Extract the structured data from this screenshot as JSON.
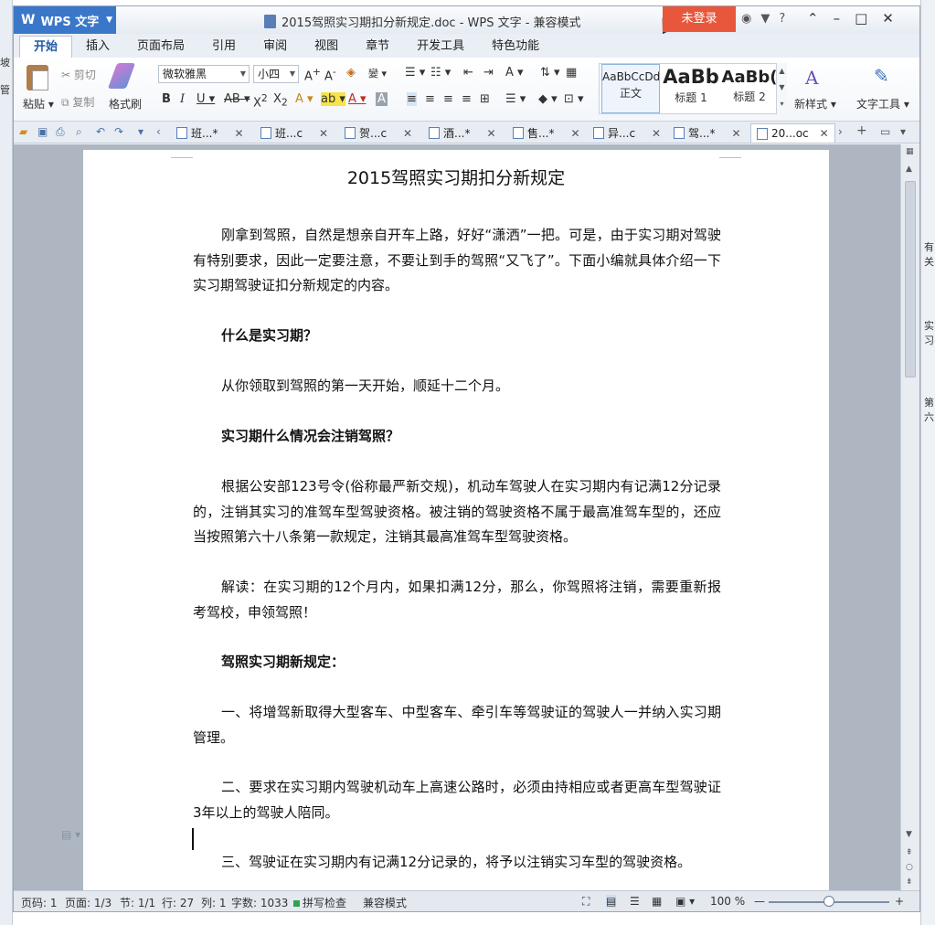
{
  "desktop": {
    "left_fragments": [
      "坡",
      "管"
    ],
    "right_fragments": [
      "有关",
      "实习",
      "第六"
    ]
  },
  "titlebar": {
    "app_button": "WPS 文字",
    "title": "2015驾照实习期扣分新规定.doc - WPS 文字 - 兼容模式",
    "login": "未登录",
    "help": "?"
  },
  "menu": {
    "tabs": [
      "开始",
      "插入",
      "页面布局",
      "引用",
      "审阅",
      "视图",
      "章节",
      "开发工具",
      "特色功能"
    ]
  },
  "ribbon": {
    "paste": "粘贴",
    "cut": "剪切",
    "copy": "复制",
    "format_painter": "格式刷",
    "font_name": "微软雅黑",
    "font_size": "小四",
    "styles": [
      {
        "preview": "AaBbCcDd",
        "name": "正文"
      },
      {
        "preview": "AaBb",
        "name": "标题 1"
      },
      {
        "preview": "AaBb(",
        "name": "标题 2"
      }
    ],
    "new_style": "新样式",
    "text_tools": "文字工具"
  },
  "doc_tabs": [
    {
      "label": "班...*"
    },
    {
      "label": "班...c"
    },
    {
      "label": "贺...c"
    },
    {
      "label": "酒...*"
    },
    {
      "label": "售...*"
    },
    {
      "label": "异...c"
    },
    {
      "label": "驾...*"
    },
    {
      "label": "20...oc"
    }
  ],
  "document": {
    "title": "2015驾照实习期扣分新规定",
    "paragraphs": [
      "刚拿到驾照，自然是想亲自开车上路，好好“潇洒”一把。可是，由于实习期对驾驶有特别要求，因此一定要注意，不要让到手的驾照“又飞了”。下面小编就具体介绍一下实习期驾驶证扣分新规定的内容。",
      "什么是实习期？",
      "从你领取到驾照的第一天开始，顺延十二个月。",
      "实习期什么情况会注销驾照？",
      "根据公安部123号令(俗称最严新交规)，机动车驾驶人在实习期内有记满12分记录的，注销其实习的准驾车型驾驶资格。被注销的驾驶资格不属于最高准驾车型的，还应当按照第六十八条第一款规定，注销其最高准驾车型驾驶资格。",
      "解读：在实习期的12个月内，如果扣满12分，那么，你驾照将注销，需要重新报考驾校，申领驾照！",
      "驾照实习期新规定：",
      "一、将增驾新取得大型客车、中型客车、牵引车等驾驶证的驾驶人一并纳入实习期管理。",
      "二、要求在实习期内驾驶机动车上高速公路时，必须由持相应或者更高车型驾驶证3年以上的驾驶人陪同。",
      "三、驾驶证在实习期内有记满12分记录的，将予以注销实习车型的驾驶资格。"
    ]
  },
  "statusbar": {
    "page_code": "页码: 1",
    "pages": "页面: 1/3",
    "section": "节: 1/1",
    "row": "行: 27",
    "col": "列: 1",
    "word_count": "字数: 1033",
    "spell_check": "拼写检查",
    "compat_mode": "兼容模式",
    "zoom": "100 %"
  }
}
